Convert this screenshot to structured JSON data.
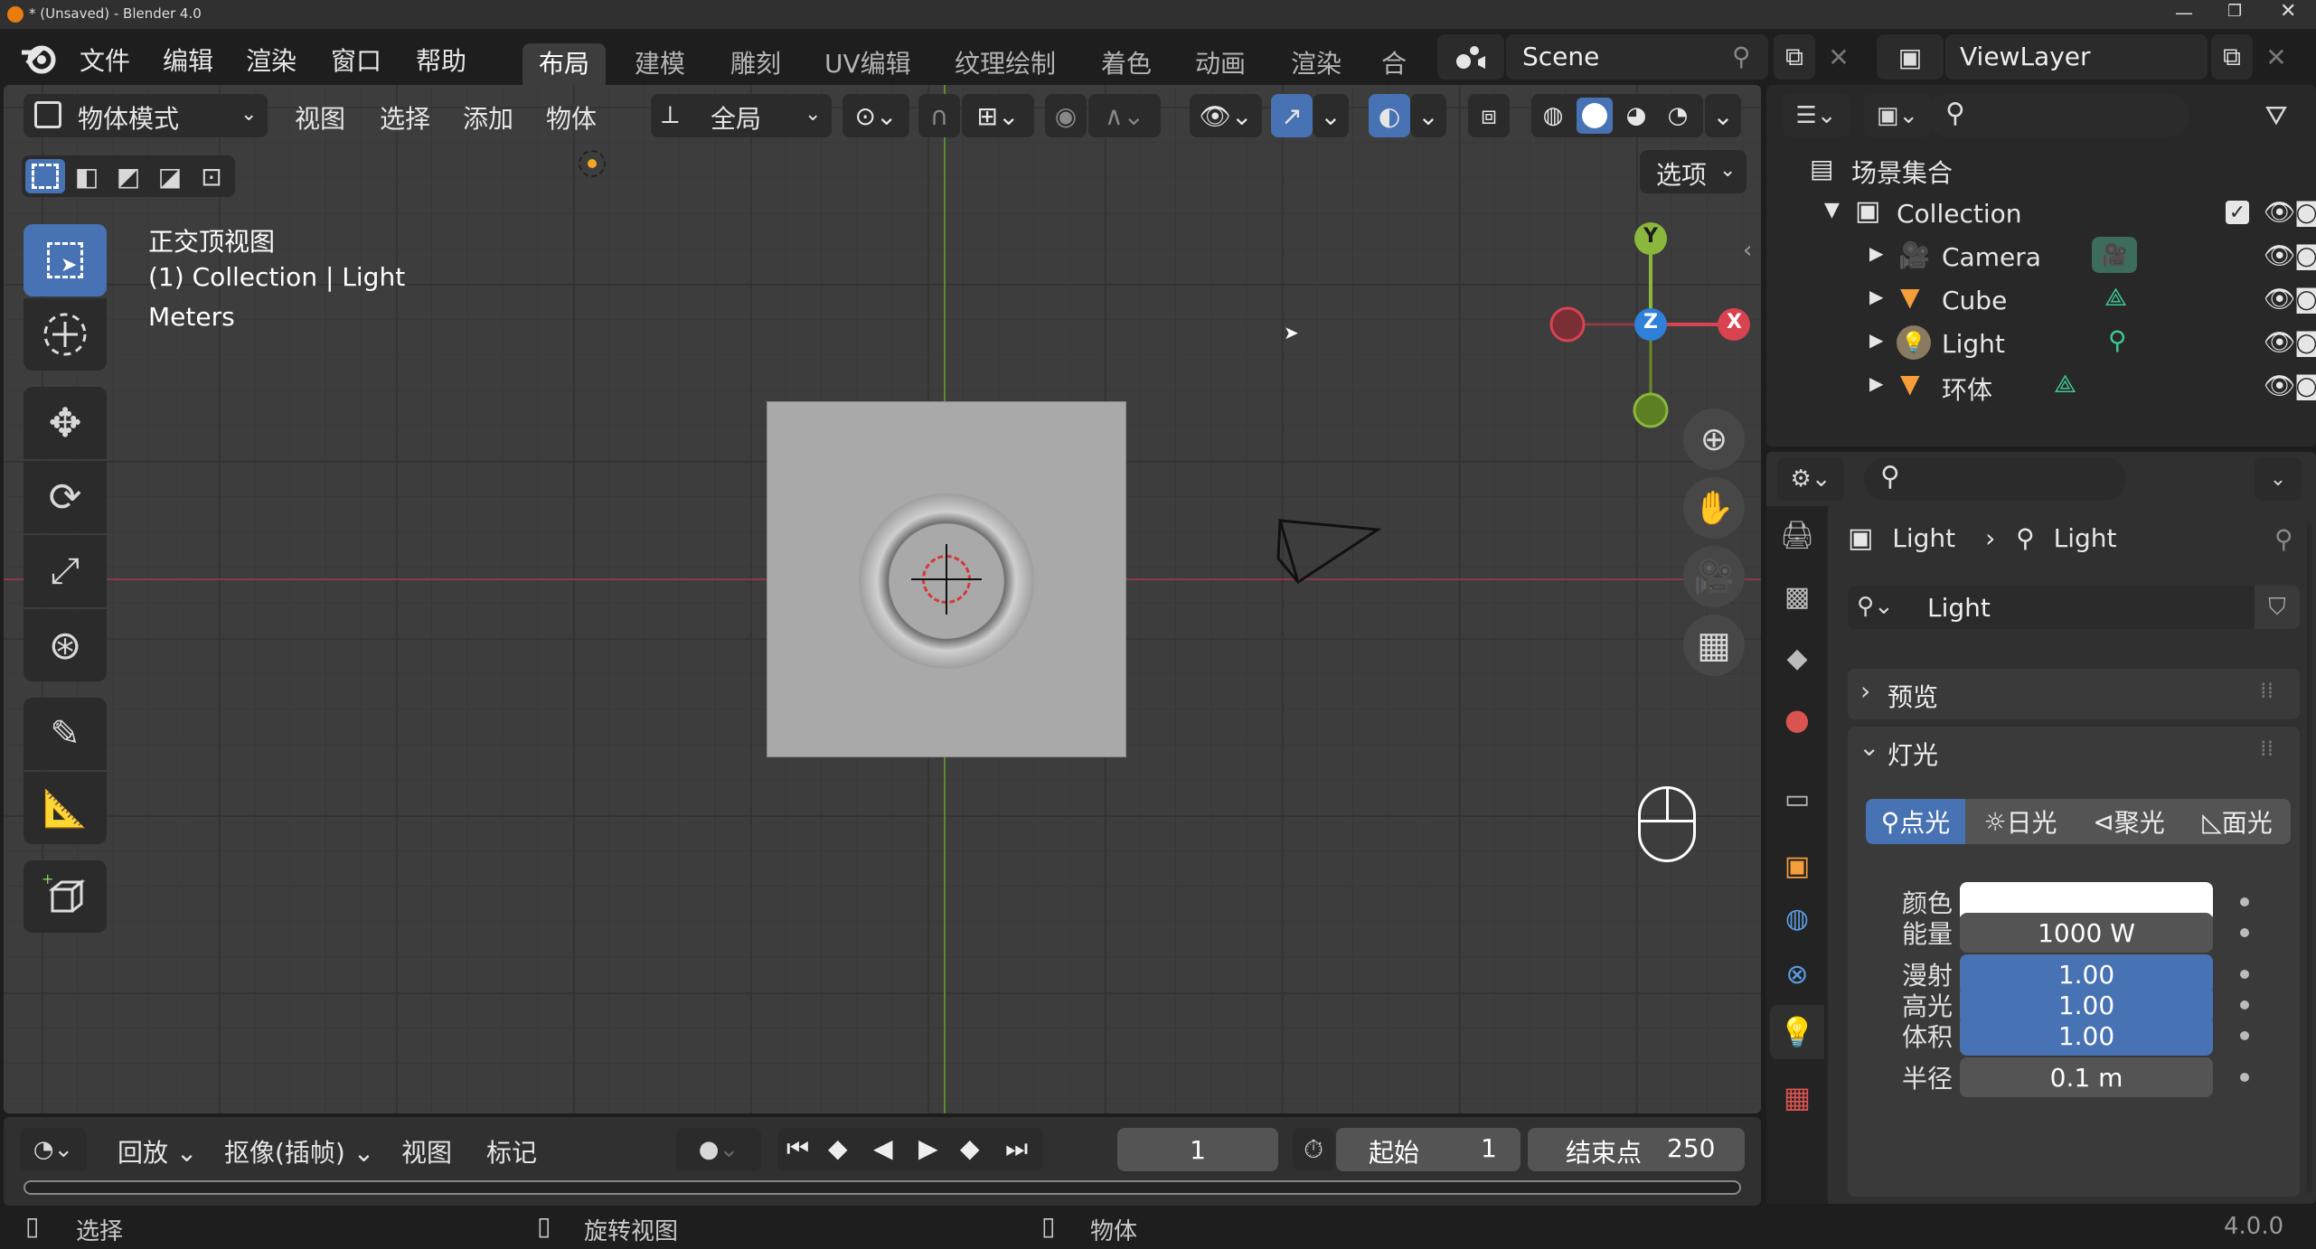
{
  "window": {
    "title": "* (Unsaved) - Blender 4.0"
  },
  "menu": [
    "文件",
    "编辑",
    "渲染",
    "窗口",
    "帮助"
  ],
  "workspaces": [
    "布局",
    "建模",
    "雕刻",
    "UV编辑",
    "纹理绘制",
    "着色",
    "动画",
    "渲染",
    "合成"
  ],
  "scene": {
    "name": "Scene",
    "view_layer": "ViewLayer"
  },
  "viewport_header": {
    "mode": "物体模式",
    "menus": [
      "视图",
      "选择",
      "添加",
      "物体"
    ],
    "transform": "全局",
    "options": "选项"
  },
  "viewport_info": {
    "view_name": "正交顶视图",
    "collection": "(1) Collection",
    "active_object": "Light",
    "units": "Meters"
  },
  "gizmo": {
    "y": "Y",
    "z": "Z",
    "x": "X"
  },
  "outliner": {
    "root": "场景集合",
    "collection": "Collection",
    "items": [
      {
        "name": "Camera"
      },
      {
        "name": "Cube"
      },
      {
        "name": "Light"
      },
      {
        "name": "环体"
      }
    ]
  },
  "properties": {
    "breadcrumb_object": "Light",
    "breadcrumb_data": "Light",
    "datablock": "Light",
    "panel_preview": "预览",
    "panel_light": "灯光",
    "light_types": [
      "点光",
      "日光",
      "聚光",
      "面光"
    ],
    "fields": {
      "color_label": "颜色",
      "color_value": "#ffffff",
      "power_label": "能量",
      "power_value": "1000 W",
      "diffuse_label": "漫射",
      "diffuse_value": "1.00",
      "specular_label": "高光",
      "specular_value": "1.00",
      "volume_label": "体积",
      "volume_value": "1.00",
      "radius_label": "半径",
      "radius_value": "0.1 m"
    }
  },
  "timeline": {
    "playback": "回放",
    "keying": "抠像(插帧)",
    "view": "视图",
    "marker": "标记",
    "current_frame": "1",
    "start_label": "起始",
    "start_value": "1",
    "end_label": "结束点",
    "end_value": "250"
  },
  "statusbar": {
    "left": "选择",
    "middle": "旋转视图",
    "right": "物体",
    "version": "4.0.0"
  }
}
